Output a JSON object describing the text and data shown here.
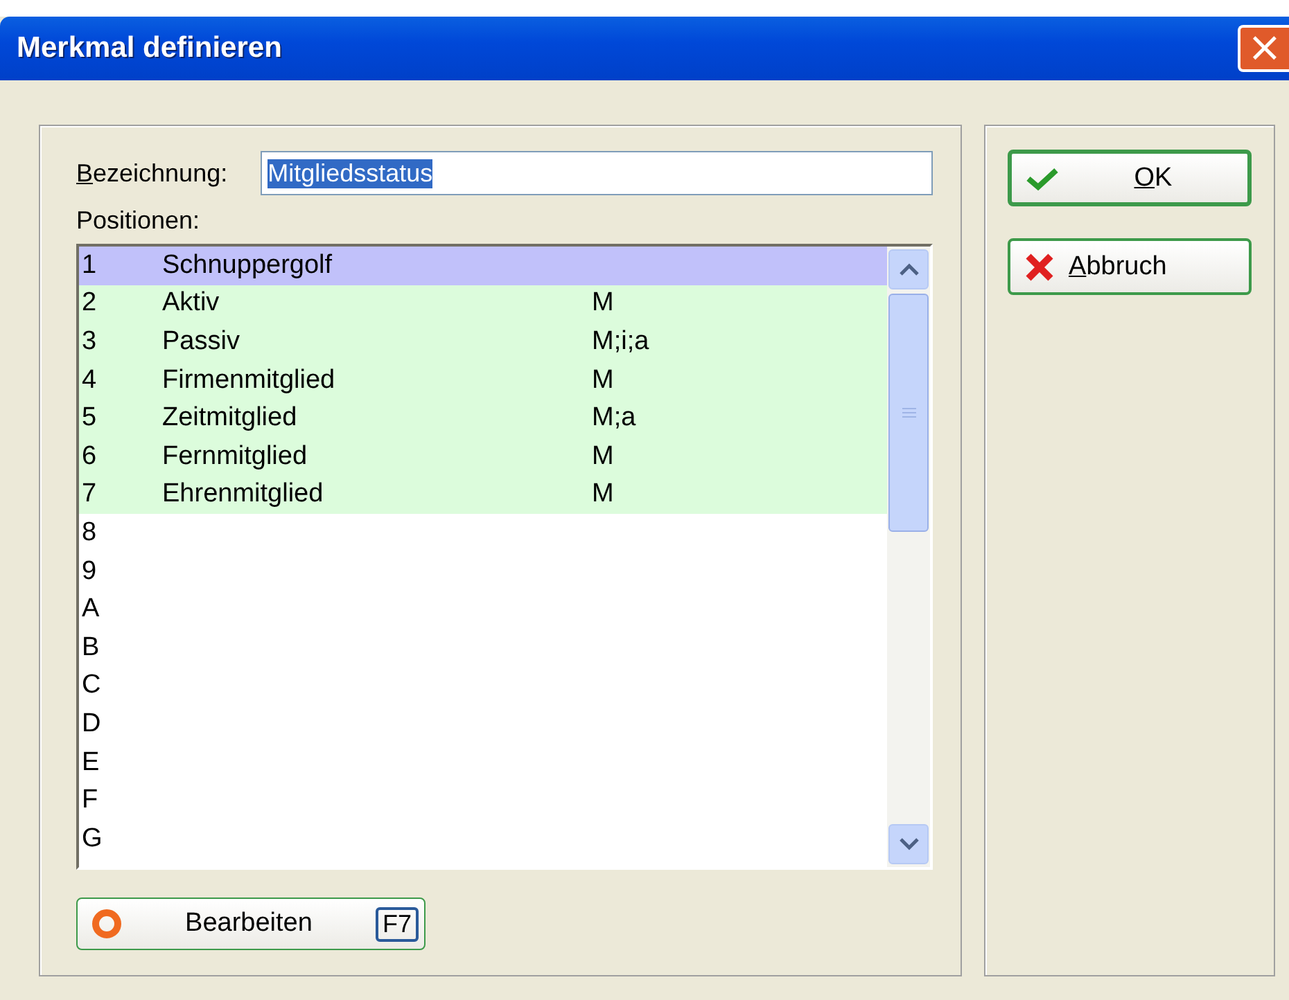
{
  "window": {
    "title": "Merkmal definieren",
    "close_symbol": "×"
  },
  "name_field": {
    "label": "Bezeichnung:",
    "label_underline_first": true,
    "value": "Mitgliedsstatus",
    "value_selected": true
  },
  "positions_label": "Positionen:",
  "rows": [
    {
      "key": "1",
      "name": "Schnuppergolf",
      "code": "",
      "selected": true,
      "defined": true
    },
    {
      "key": "2",
      "name": "Aktiv",
      "code": "M",
      "selected": false,
      "defined": true
    },
    {
      "key": "3",
      "name": "Passiv",
      "code": "M;i;a",
      "selected": false,
      "defined": true
    },
    {
      "key": "4",
      "name": "Firmenmitglied",
      "code": "M",
      "selected": false,
      "defined": true
    },
    {
      "key": "5",
      "name": "Zeitmitglied",
      "code": "M;a",
      "selected": false,
      "defined": true
    },
    {
      "key": "6",
      "name": "Fernmitglied",
      "code": "M",
      "selected": false,
      "defined": true
    },
    {
      "key": "7",
      "name": "Ehrenmitglied",
      "code": "M",
      "selected": false,
      "defined": true
    },
    {
      "key": "8",
      "name": "",
      "code": "",
      "selected": false,
      "defined": false
    },
    {
      "key": "9",
      "name": "",
      "code": "",
      "selected": false,
      "defined": false
    },
    {
      "key": "A",
      "name": "",
      "code": "",
      "selected": false,
      "defined": false
    },
    {
      "key": "B",
      "name": "",
      "code": "",
      "selected": false,
      "defined": false
    },
    {
      "key": "C",
      "name": "",
      "code": "",
      "selected": false,
      "defined": false
    },
    {
      "key": "D",
      "name": "",
      "code": "",
      "selected": false,
      "defined": false
    },
    {
      "key": "E",
      "name": "",
      "code": "",
      "selected": false,
      "defined": false
    },
    {
      "key": "F",
      "name": "",
      "code": "",
      "selected": false,
      "defined": false
    },
    {
      "key": "G",
      "name": "",
      "code": "",
      "selected": false,
      "defined": false
    }
  ],
  "edit_button": {
    "label": "Bearbeiten",
    "shortcut": "F7"
  },
  "buttons": [
    {
      "kind": "ok",
      "label": "OK",
      "underline_first": true
    },
    {
      "kind": "cancel",
      "label": "Abbruch",
      "underline_first": true
    }
  ]
}
